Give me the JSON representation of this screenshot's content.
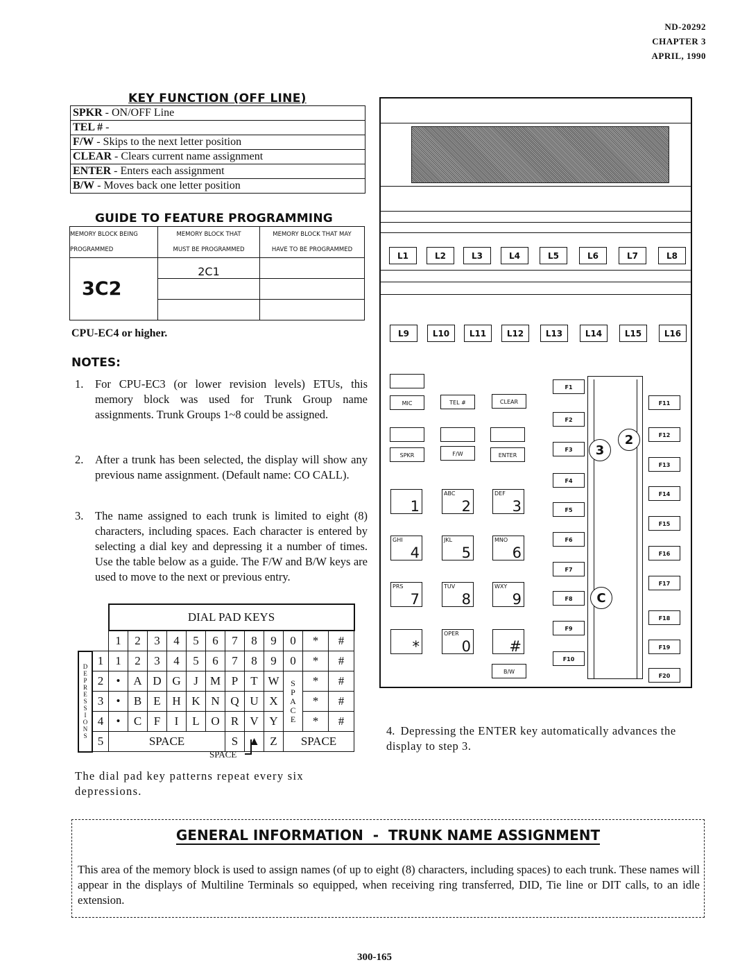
{
  "header": {
    "doc_id": "ND-20292",
    "chapter": "CHAPTER 3",
    "date": "APRIL, 1990"
  },
  "key_function": {
    "title": "KEY FUNCTION (OFF LINE)",
    "rows": [
      {
        "key": "SPKR",
        "desc": " - ON/OFF Line"
      },
      {
        "key": "TEL #",
        "desc": " -"
      },
      {
        "key": "F/W",
        "desc": " - Skips to the next letter position"
      },
      {
        "key": "CLEAR",
        "desc": " - Clears current name assignment"
      },
      {
        "key": "ENTER",
        "desc": " - Enters each assignment"
      },
      {
        "key": "B/W",
        "desc": " - Moves back one letter position"
      }
    ]
  },
  "guide": {
    "title": "GUIDE TO FEATURE PROGRAMMING",
    "col1": [
      "MEMORY BLOCK BEING",
      "PROGRAMMED"
    ],
    "col2": [
      "MEMORY BLOCK THAT",
      "MUST BE PROGRAMMED"
    ],
    "col3": [
      "MEMORY BLOCK THAT MAY",
      "HAVE TO BE PROGRAMMED"
    ],
    "block_programmed": "3C2",
    "must_program": [
      "2C1",
      "",
      ""
    ],
    "may_program": [
      "",
      "",
      ""
    ],
    "requirement": "CPU-EC4 or higher."
  },
  "notes": {
    "title": "NOTES:",
    "items": [
      {
        "num": "1.",
        "text": "For CPU-EC3 (or lower revision levels) ETUs, this memory block was used for Trunk Group name assignments. Trunk Groups 1~8 could be assigned."
      },
      {
        "num": "2.",
        "text": "After a trunk has been selected, the display will show any previous name assignment. (Default name: CO CALL)."
      },
      {
        "num": "3.",
        "text": "The name assigned to each trunk is limited to eight (8) characters, including spaces. Each character is entered by selecting a dial key and depressing it a number of times. Use the table below as a guide. The F/W and B/W keys are used to move to the next or previous entry."
      },
      {
        "num": "4.",
        "text": "Depressing the ENTER key automatically advances the display to step 3."
      }
    ]
  },
  "dial_pad_table": {
    "title": "DIAL PAD KEYS",
    "side_label": "DEPRESSIONS",
    "keys": [
      "1",
      "2",
      "3",
      "4",
      "5",
      "6",
      "7",
      "8",
      "9",
      "0",
      "*",
      "#"
    ],
    "rows": [
      {
        "depression": "1",
        "cells": [
          "1",
          "2",
          "3",
          "4",
          "5",
          "6",
          "7",
          "8",
          "9",
          "0",
          "*",
          "#"
        ]
      },
      {
        "depression": "2",
        "cells": [
          "•",
          "A",
          "D",
          "G",
          "J",
          "M",
          "P",
          "T",
          "W",
          "SPACE",
          "*",
          "#"
        ]
      },
      {
        "depression": "3",
        "cells": [
          "•",
          "B",
          "E",
          "H",
          "K",
          "N",
          "Q",
          "U",
          "X",
          "",
          "*",
          "#"
        ]
      },
      {
        "depression": "4",
        "cells": [
          "•",
          "C",
          "F",
          "I",
          "L",
          "O",
          "R",
          "V",
          "Y",
          "",
          "*",
          "#"
        ]
      },
      {
        "depression": "5",
        "cells": [
          "SPACE",
          "S",
          "▲",
          "Z",
          "SPACE"
        ]
      }
    ],
    "arrow_label": "SPACE",
    "footnote": "The dial pad key patterns repeat every six depressions."
  },
  "phone": {
    "line_keys_row1": [
      "L1",
      "L2",
      "L3",
      "L4",
      "L5",
      "L6",
      "L7",
      "L8"
    ],
    "line_keys_row2": [
      "L9",
      "L10",
      "L11",
      "L12",
      "L13",
      "L14",
      "L15",
      "L16"
    ],
    "control_keys": [
      "MIC",
      "TEL #",
      "CLEAR",
      "SPKR",
      "F/W",
      "ENTER",
      "B/W"
    ],
    "dial_keys": [
      {
        "letters": "",
        "digit": "1"
      },
      {
        "letters": "ABC",
        "digit": "2"
      },
      {
        "letters": "DEF",
        "digit": "3"
      },
      {
        "letters": "GHI",
        "digit": "4"
      },
      {
        "letters": "JKL",
        "digit": "5"
      },
      {
        "letters": "MNO",
        "digit": "6"
      },
      {
        "letters": "PRS",
        "digit": "7"
      },
      {
        "letters": "TUV",
        "digit": "8"
      },
      {
        "letters": "WXY",
        "digit": "9"
      },
      {
        "letters": "",
        "digit": "*"
      },
      {
        "letters": "OPER",
        "digit": "0"
      },
      {
        "letters": "",
        "digit": "#"
      }
    ],
    "function_keys_left": [
      "F1",
      "F2",
      "F3",
      "F4",
      "F5",
      "F6",
      "F7",
      "F8",
      "F9",
      "F10"
    ],
    "function_keys_right": [
      "F11",
      "F12",
      "F13",
      "F14",
      "F15",
      "F16",
      "F17",
      "F18",
      "F19",
      "F20"
    ],
    "callouts": [
      "3",
      "2",
      "C"
    ]
  },
  "general_info": {
    "title": "GENERAL INFORMATION  -  TRUNK NAME ASSIGNMENT",
    "body": "This area of the memory block is used to assign names (of up to eight (8) characters, including spaces) to each trunk. These names will appear in the displays of Multiline Terminals so equipped, when receiving ring transferred, DID, Tie line or DIT calls, to an idle extension."
  },
  "page_number": "300-165"
}
